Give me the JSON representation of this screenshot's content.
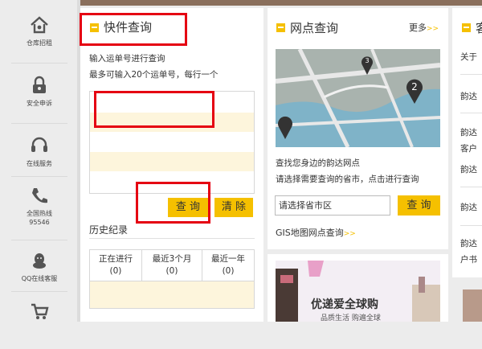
{
  "sidebar": {
    "items": [
      {
        "label": "仓库招租",
        "icon": "house-icon"
      },
      {
        "label": "安全申诉",
        "icon": "lock-icon"
      },
      {
        "label": "在线服务",
        "icon": "headset-icon"
      },
      {
        "label": "全国热线",
        "sub": "95546",
        "icon": "phone-icon"
      },
      {
        "label": "QQ在线客服",
        "icon": "qq-icon"
      },
      {
        "label": "",
        "icon": "cart-icon"
      }
    ]
  },
  "express": {
    "title": "快件查询",
    "instruction1": "输入运单号进行查询",
    "instruction2": "最多可输入20个运单号，每行一个",
    "query_btn": "查 询",
    "clear_btn": "清 除",
    "history_title": "历史纪录",
    "history_headers": [
      "正在进行",
      "最近3个月",
      "最近一年"
    ],
    "history_counts": [
      "(0)",
      "(0)",
      "(0)"
    ]
  },
  "outlet": {
    "title": "网点查询",
    "more": "更多",
    "more_arrow": ">>",
    "desc1": "查找您身边的韵达网点",
    "desc2": "请选择需要查询的省市，点击进行查询",
    "select_placeholder": "请选择省市区",
    "query_btn": "查 询",
    "gis_link": "GIS地图网点查询",
    "gis_arrow": ">>",
    "map_markers": [
      "3",
      "2"
    ]
  },
  "right_col": {
    "title_partial": "客",
    "lines": [
      "关于",
      "韵达",
      "韵达",
      "客户",
      "韵达",
      "韵达",
      "韵达",
      "户书"
    ]
  },
  "promo": {
    "headline": "优递爱全球购",
    "sub": "品质生活 购遍全球"
  },
  "colors": {
    "accent": "#f5c000",
    "highlight": "#e50012"
  }
}
